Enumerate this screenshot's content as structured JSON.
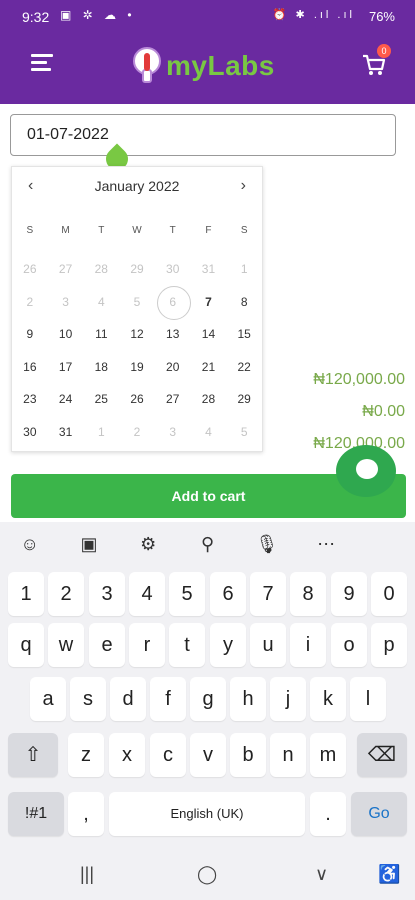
{
  "status": {
    "time": "9:32",
    "left_icons": "▣ ✲ ☁ •",
    "right_icons": "⏰ ✱ .ıl .ıl",
    "battery": "76%"
  },
  "appbar": {
    "menu_icon": "hamburger-icon",
    "logo_text": "myLabs",
    "cart_icon": "cart-icon",
    "cart_count": "0"
  },
  "date_field": {
    "value": "01-07-2022"
  },
  "calendar": {
    "month_label": "January 2022",
    "prev_icon": "‹",
    "next_icon": "›",
    "weekdays": [
      "S",
      "M",
      "T",
      "W",
      "T",
      "F",
      "S"
    ],
    "weeks": [
      [
        "26",
        "27",
        "28",
        "29",
        "30",
        "31",
        "1"
      ],
      [
        "2",
        "3",
        "4",
        "5",
        "6",
        "7",
        "8"
      ],
      [
        "9",
        "10",
        "11",
        "12",
        "13",
        "14",
        "15"
      ],
      [
        "16",
        "17",
        "18",
        "19",
        "20",
        "21",
        "22"
      ],
      [
        "23",
        "24",
        "25",
        "26",
        "27",
        "28",
        "29"
      ],
      [
        "30",
        "31",
        "1",
        "2",
        "3",
        "4",
        "5"
      ]
    ]
  },
  "prices": {
    "subtotal": "₦120,000.00",
    "discount": "₦0.00",
    "total": "₦120,000.00"
  },
  "add_to_cart_label": "Add to cart",
  "keyboard": {
    "tools": [
      "☺",
      "▣",
      "⚙",
      "⚲",
      "🎙",
      "⋯"
    ],
    "row_numbers": [
      "1",
      "2",
      "3",
      "4",
      "5",
      "6",
      "7",
      "8",
      "9",
      "0"
    ],
    "row_q": [
      "q",
      "w",
      "e",
      "r",
      "t",
      "y",
      "u",
      "i",
      "o",
      "p"
    ],
    "row_a": [
      "a",
      "s",
      "d",
      "f",
      "g",
      "h",
      "j",
      "k",
      "l"
    ],
    "row_z": [
      "z",
      "x",
      "c",
      "v",
      "b",
      "n",
      "m"
    ],
    "shift": "⇧",
    "backspace": "⌫",
    "symbols": "!#1",
    "comma": ",",
    "space": "English (UK)",
    "period": ".",
    "go": "Go"
  },
  "navbar": {
    "recents": "|||",
    "home": "◯",
    "back": "∨",
    "accessibility": "♿"
  },
  "colors": {
    "brand_purple": "#6a2aa0",
    "brand_green": "#79c843",
    "button_green": "#3bb54a"
  }
}
